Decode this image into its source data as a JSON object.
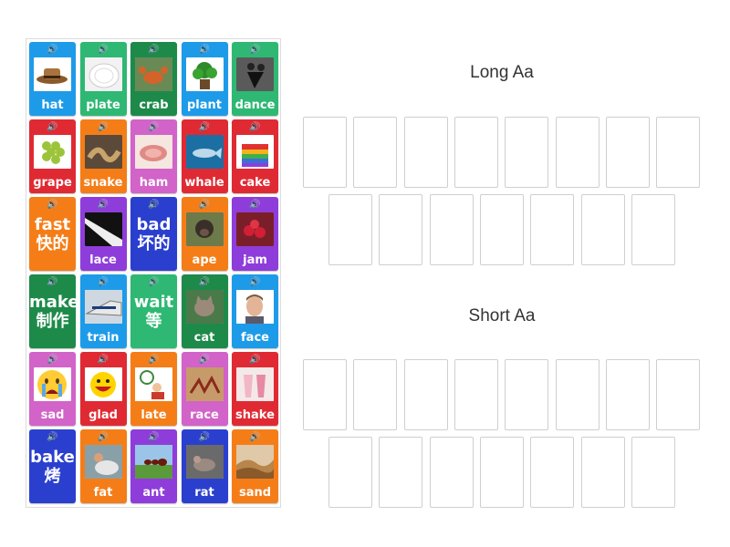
{
  "groups": {
    "long": {
      "title": "Long Aa",
      "slot_count": 15
    },
    "short": {
      "title": "Short Aa",
      "slot_count": 15
    }
  },
  "icons": {
    "speaker": "speaker-icon"
  },
  "colors": {
    "blue": "#1e9be8",
    "green": "#2eb873",
    "darkgreen": "#1d8a4a",
    "red": "#e02a33",
    "orange": "#f57d18",
    "pink": "#d263c8",
    "purple": "#8e3dda",
    "navy": "#2b3fcf"
  },
  "cards": [
    {
      "label": "hat",
      "color": "blue",
      "image": "hat"
    },
    {
      "label": "plate",
      "color": "green",
      "image": "plate"
    },
    {
      "label": "crab",
      "color": "darkgreen",
      "image": "crab"
    },
    {
      "label": "plant",
      "color": "blue",
      "image": "plant"
    },
    {
      "label": "dance",
      "color": "green",
      "image": "dance"
    },
    {
      "label": "grape",
      "color": "red",
      "image": "grape"
    },
    {
      "label": "snake",
      "color": "orange",
      "image": "snake"
    },
    {
      "label": "ham",
      "color": "pink",
      "image": "ham"
    },
    {
      "label": "whale",
      "color": "red",
      "image": "whale"
    },
    {
      "label": "cake",
      "color": "red",
      "image": "cake"
    },
    {
      "label": "fast",
      "zh": "快的",
      "color": "orange",
      "image": ""
    },
    {
      "label": "lace",
      "color": "purple",
      "image": "lace"
    },
    {
      "label": "bad",
      "zh": "坏的",
      "color": "navy",
      "image": ""
    },
    {
      "label": "ape",
      "color": "orange",
      "image": "ape"
    },
    {
      "label": "jam",
      "color": "purple",
      "image": "jam"
    },
    {
      "label": "make",
      "zh": "制作",
      "color": "darkgreen",
      "image": ""
    },
    {
      "label": "train",
      "color": "blue",
      "image": "train"
    },
    {
      "label": "wait",
      "zh": "等",
      "color": "green",
      "image": ""
    },
    {
      "label": "cat",
      "color": "darkgreen",
      "image": "cat"
    },
    {
      "label": "face",
      "color": "blue",
      "image": "face"
    },
    {
      "label": "sad",
      "color": "pink",
      "image": "sad"
    },
    {
      "label": "glad",
      "color": "red",
      "image": "glad"
    },
    {
      "label": "late",
      "color": "orange",
      "image": "late"
    },
    {
      "label": "race",
      "color": "pink",
      "image": "race"
    },
    {
      "label": "shake",
      "color": "red",
      "image": "shake"
    },
    {
      "label": "bake",
      "zh": "烤",
      "color": "navy",
      "image": ""
    },
    {
      "label": "fat",
      "color": "orange",
      "image": "fat"
    },
    {
      "label": "ant",
      "color": "purple",
      "image": "ant"
    },
    {
      "label": "rat",
      "color": "navy",
      "image": "rat"
    },
    {
      "label": "sand",
      "color": "orange",
      "image": "sand"
    }
  ]
}
